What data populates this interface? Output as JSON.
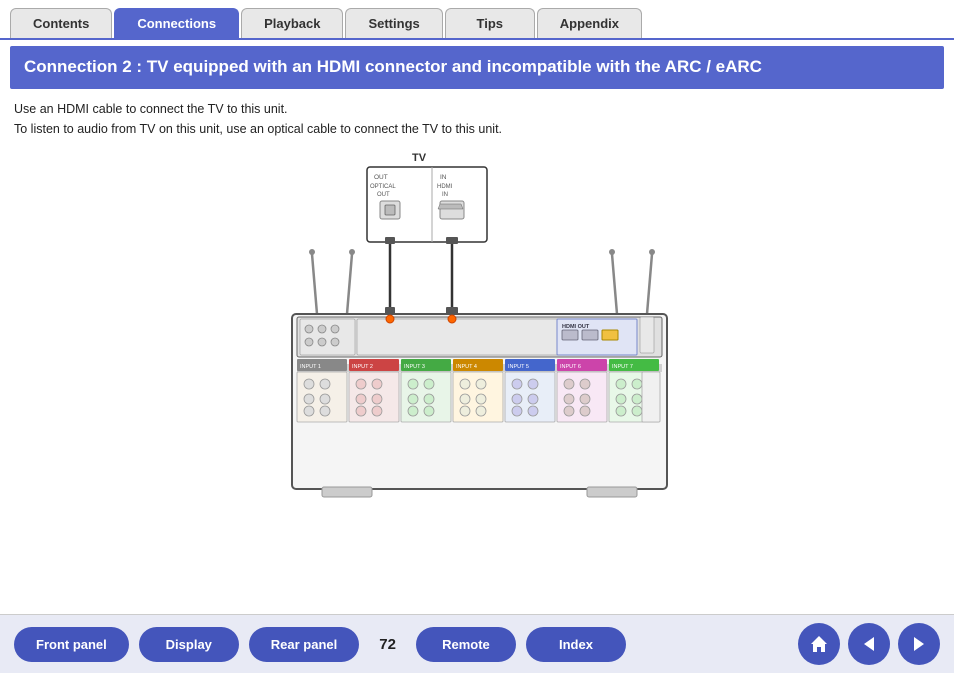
{
  "nav": {
    "tabs": [
      {
        "label": "Contents",
        "active": false
      },
      {
        "label": "Connections",
        "active": true
      },
      {
        "label": "Playback",
        "active": false
      },
      {
        "label": "Settings",
        "active": false
      },
      {
        "label": "Tips",
        "active": false
      },
      {
        "label": "Appendix",
        "active": false
      }
    ]
  },
  "section": {
    "title": "Connection 2 : TV equipped with an HDMI connector and incompatible with the ARC / eARC"
  },
  "description": {
    "line1": "Use an HDMI cable to connect the TV to this unit.",
    "line2": "To listen to audio from TV on this unit, use an optical cable to connect the TV to this unit."
  },
  "diagram": {
    "tv_label": "TV",
    "out_label": "OUT",
    "optical_label": "OPTICAL",
    "out2_label": "OUT",
    "in_label": "IN",
    "hdmi_label": "HDMI",
    "in2_label": "IN"
  },
  "bottom": {
    "front_panel": "Front panel",
    "display": "Display",
    "rear_panel": "Rear panel",
    "page_number": "72",
    "remote": "Remote",
    "index": "Index"
  }
}
